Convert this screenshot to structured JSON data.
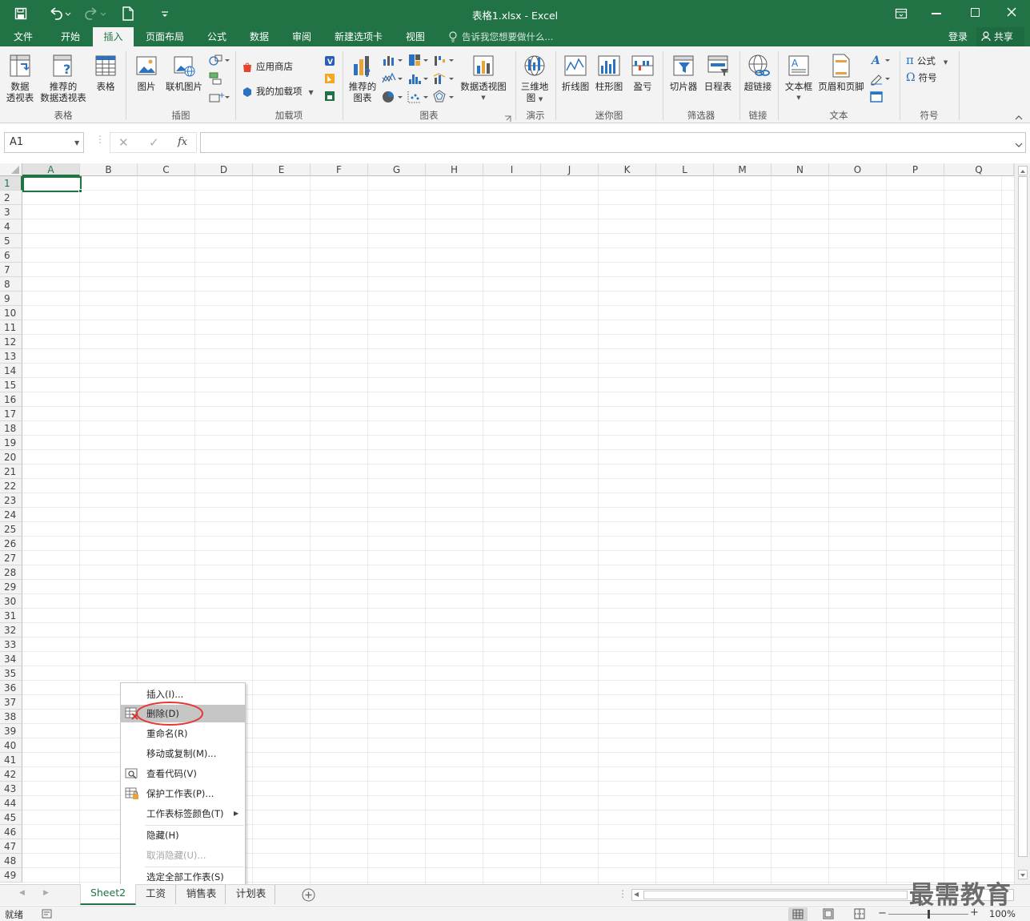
{
  "window": {
    "title": "表格1.xlsx - Excel"
  },
  "qat": {
    "icons": [
      "save-icon",
      "undo-icon",
      "redo-icon",
      "new-file-icon",
      "customize-icon"
    ]
  },
  "tabs": [
    {
      "label": "文件",
      "active": false
    },
    {
      "label": "开始",
      "active": false
    },
    {
      "label": "插入",
      "active": true
    },
    {
      "label": "页面布局",
      "active": false
    },
    {
      "label": "公式",
      "active": false
    },
    {
      "label": "数据",
      "active": false
    },
    {
      "label": "审阅",
      "active": false
    },
    {
      "label": "新建选项卡",
      "active": false
    },
    {
      "label": "视图",
      "active": false
    }
  ],
  "tell_me": "告诉我您想要做什么...",
  "account": {
    "signin": "登录",
    "share": "共享"
  },
  "ribbon": {
    "groups": [
      "表格",
      "插图",
      "加载项",
      "图表",
      "演示",
      "迷你图",
      "筛选器",
      "链接",
      "文本",
      "符号"
    ],
    "pivot1": "数据",
    "pivot2": "透视表",
    "rec_pivot1": "推荐的",
    "rec_pivot2": "数据透视表",
    "table": "表格",
    "picture": "图片",
    "online_picture": "联机图片",
    "store": "应用商店",
    "my_addins": "我的加载项",
    "rec_chart1": "推荐的",
    "rec_chart2": "图表",
    "pivot_chart": "数据透视图",
    "map3d1": "三维地",
    "map3d2": "图",
    "line": "折线图",
    "column": "柱形图",
    "winloss": "盈亏",
    "slicer": "切片器",
    "timeline": "日程表",
    "hyperlink": "超链接",
    "textbox": "文本框",
    "header_footer": "页眉和页脚",
    "equation": "公式",
    "symbol": "符号"
  },
  "formula_bar": {
    "name_box": "A1",
    "fx": "fx",
    "formula": ""
  },
  "columns": [
    "A",
    "B",
    "C",
    "D",
    "E",
    "F",
    "G",
    "H",
    "I",
    "J",
    "K",
    "L",
    "M",
    "N",
    "O",
    "P",
    "Q"
  ],
  "rows": [
    "1",
    "2",
    "3",
    "4",
    "5",
    "6",
    "7",
    "8",
    "9",
    "10",
    "11",
    "12",
    "13",
    "14",
    "15",
    "16",
    "17",
    "18",
    "19",
    "20",
    "21",
    "22",
    "23",
    "24",
    "25",
    "26",
    "27",
    "28",
    "29",
    "30",
    "31",
    "32",
    "33",
    "34",
    "35",
    "36",
    "37",
    "38",
    "39",
    "40",
    "41",
    "42",
    "43",
    "44",
    "45",
    "46",
    "47",
    "48",
    "49"
  ],
  "context_menu": {
    "items": [
      {
        "label": "插入(I)...",
        "enabled": true,
        "icon": ""
      },
      {
        "label": "删除(D)",
        "enabled": true,
        "icon": "delete-sheet-icon",
        "highlighted": true
      },
      {
        "label": "重命名(R)",
        "enabled": true,
        "icon": ""
      },
      {
        "label": "移动或复制(M)...",
        "enabled": true,
        "icon": ""
      },
      {
        "label": "查看代码(V)",
        "enabled": true,
        "icon": "view-code-icon"
      },
      {
        "label": "保护工作表(P)...",
        "enabled": true,
        "icon": "protect-sheet-icon"
      },
      {
        "label": "工作表标签颜色(T)",
        "enabled": true,
        "icon": "",
        "submenu": true
      },
      {
        "label": "隐藏(H)",
        "enabled": true,
        "icon": ""
      },
      {
        "label": "取消隐藏(U)...",
        "enabled": false,
        "icon": ""
      },
      {
        "label": "选定全部工作表(S)",
        "enabled": true,
        "icon": ""
      }
    ]
  },
  "sheets": [
    {
      "label": "Sheet2",
      "active": true
    },
    {
      "label": "工资",
      "active": false
    },
    {
      "label": "销售表",
      "active": false
    },
    {
      "label": "计划表",
      "active": false
    }
  ],
  "status": {
    "ready": "就绪",
    "zoom": "100%",
    "zoom_fraction": 0.5
  },
  "watermark": "最需教育",
  "colors": {
    "excel_green": "#217346",
    "highlight_circle": "#e53935"
  }
}
